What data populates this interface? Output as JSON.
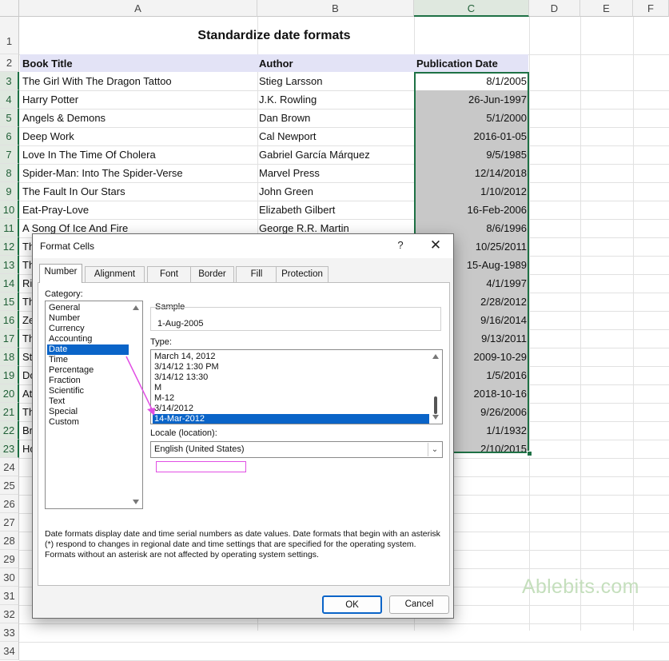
{
  "sheet": {
    "columns": [
      "A",
      "B",
      "C",
      "D",
      "E",
      "F"
    ],
    "title": "Standardize date  formats",
    "headers": {
      "title": "Book Title",
      "author": "Author",
      "date": "Publication Date"
    },
    "rows": [
      {
        "n": "3",
        "title": "The Girl With The Dragon Tattoo",
        "author": "Stieg Larsson",
        "date": "8/1/2005"
      },
      {
        "n": "4",
        "title": "Harry Potter",
        "author": "J.K. Rowling",
        "date": "26-Jun-1997"
      },
      {
        "n": "5",
        "title": "Angels & Demons",
        "author": "Dan Brown",
        "date": "5/1/2000"
      },
      {
        "n": "6",
        "title": "Deep Work",
        "author": "Cal Newport",
        "date": "2016-01-05"
      },
      {
        "n": "7",
        "title": "Love In The Time Of Cholera",
        "author": "Gabriel García Márquez",
        "date": "9/5/1985"
      },
      {
        "n": "8",
        "title": "Spider-Man: Into The Spider-Verse",
        "author": "Marvel Press",
        "date": "12/14/2018"
      },
      {
        "n": "9",
        "title": "The Fault In Our Stars",
        "author": "John Green",
        "date": "1/10/2012"
      },
      {
        "n": "10",
        "title": "Eat-Pray-Love",
        "author": "Elizabeth Gilbert",
        "date": "16-Feb-2006"
      },
      {
        "n": "11",
        "title": "A Song Of Ice And Fire",
        "author": "George R.R. Martin",
        "date": "8/6/1996"
      },
      {
        "n": "12",
        "title": "Th",
        "author": "",
        "date": "10/25/2011"
      },
      {
        "n": "13",
        "title": "Th",
        "author": "",
        "date": "15-Aug-1989"
      },
      {
        "n": "14",
        "title": "Ri",
        "author": "",
        "date": "4/1/1997"
      },
      {
        "n": "15",
        "title": "Th",
        "author": "",
        "date": "2/28/2012"
      },
      {
        "n": "16",
        "title": "Ze",
        "author": "",
        "date": "9/16/2014"
      },
      {
        "n": "17",
        "title": "Th",
        "author": "",
        "date": "9/13/2011"
      },
      {
        "n": "18",
        "title": "St",
        "author": "",
        "date": "2009-10-29"
      },
      {
        "n": "19",
        "title": "Do",
        "author": "",
        "date": "1/5/2016"
      },
      {
        "n": "20",
        "title": "At",
        "author": "",
        "date": "2018-10-16"
      },
      {
        "n": "21",
        "title": "Th",
        "author": "",
        "date": "9/26/2006"
      },
      {
        "n": "22",
        "title": "Br",
        "author": "",
        "date": "1/1/1932"
      },
      {
        "n": "23",
        "title": "Ho",
        "author": "",
        "date": "2/10/2015"
      }
    ],
    "empty_rows": [
      "24",
      "25",
      "26",
      "27",
      "28",
      "29",
      "30",
      "31",
      "32",
      "33",
      "34"
    ],
    "row1": "1",
    "row2": "2"
  },
  "dialog": {
    "title": "Format Cells",
    "help": "?",
    "close": "✕",
    "tabs": [
      "Number",
      "Alignment",
      "Font",
      "Border",
      "Fill",
      "Protection"
    ],
    "category_label": "Category:",
    "categories": [
      "General",
      "Number",
      "Currency",
      "Accounting",
      "Date",
      "Time",
      "Percentage",
      "Fraction",
      "Scientific",
      "Text",
      "Special",
      "Custom"
    ],
    "selected_category": "Date",
    "sample_label": "Sample",
    "sample_value": "1-Aug-2005",
    "type_label": "Type:",
    "types": [
      "March 14, 2012",
      "3/14/12 1:30 PM",
      "3/14/12 13:30",
      "M",
      "M-12",
      "3/14/2012",
      "14-Mar-2012"
    ],
    "selected_type": "14-Mar-2012",
    "locale_label": "Locale (location):",
    "locale_value": "English (United States)",
    "description": "Date formats display date and time serial numbers as date values.  Date formats that begin with an asterisk (*) respond to changes in regional date and time settings that are specified for the operating system. Formats without an asterisk are not affected by operating system settings.",
    "ok": "OK",
    "cancel": "Cancel"
  },
  "watermark": "Ablebits.com",
  "colors": {
    "accent": "#1e7145",
    "selection": "#0a64c8",
    "highlight": "#e14fe4",
    "header_band": "#e3e3f6"
  }
}
